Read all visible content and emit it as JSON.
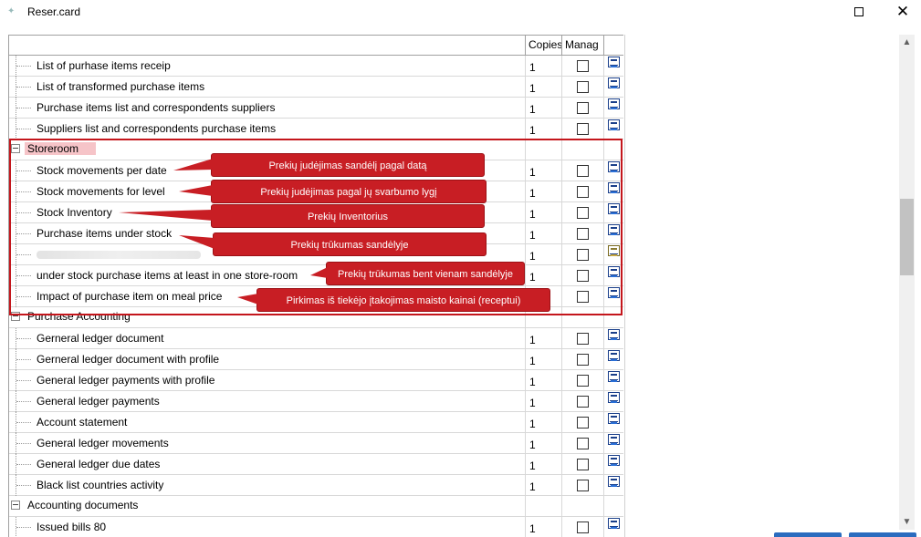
{
  "window": {
    "title": "Reser.card",
    "maximize_icon": "maximize-icon",
    "close_glyph": "✕"
  },
  "grid": {
    "columns": [
      "",
      "Copies",
      "Manag",
      ""
    ],
    "rows": [
      {
        "type": "item",
        "label": "List of purhase items receip",
        "copies": "1",
        "icon": "report-icon"
      },
      {
        "type": "item",
        "label": "List of transformed purchase items",
        "copies": "1",
        "icon": "report-icon"
      },
      {
        "type": "item",
        "label": "Purchase items list and correspondents suppliers",
        "copies": "1",
        "icon": "report-icon"
      },
      {
        "type": "item",
        "label": "Suppliers list and correspondents purchase items",
        "copies": "1",
        "icon": "report-icon"
      },
      {
        "type": "group",
        "label": "Storeroom",
        "selected": true
      },
      {
        "type": "item",
        "label": "Stock movements per date",
        "copies": "1",
        "icon": "report-icon"
      },
      {
        "type": "item",
        "label": "Stock movements for level",
        "copies": "1",
        "icon": "report-icon"
      },
      {
        "type": "item",
        "label": "Stock Inventory",
        "copies": "1",
        "icon": "report-icon"
      },
      {
        "type": "item",
        "label": "Purchase items under stock",
        "copies": "1",
        "icon": "report-icon"
      },
      {
        "type": "item",
        "label": "",
        "copies": "1",
        "icon": "report-alt-icon",
        "blurred": true
      },
      {
        "type": "item",
        "label": "under stock purchase items at least in one store-room",
        "copies": "1",
        "icon": "report-icon"
      },
      {
        "type": "item",
        "label": "Impact of purchase item on meal price",
        "copies": "",
        "icon": "report-icon"
      },
      {
        "type": "group",
        "label": "Purchase Accounting"
      },
      {
        "type": "item",
        "label": "Gerneral ledger document",
        "copies": "1",
        "icon": "report-icon"
      },
      {
        "type": "item",
        "label": "Gerneral ledger document with profile",
        "copies": "1",
        "icon": "report-icon"
      },
      {
        "type": "item",
        "label": "General ledger payments with profile",
        "copies": "1",
        "icon": "report-icon"
      },
      {
        "type": "item",
        "label": "General ledger payments",
        "copies": "1",
        "icon": "report-icon"
      },
      {
        "type": "item",
        "label": "Account statement",
        "copies": "1",
        "icon": "report-icon"
      },
      {
        "type": "item",
        "label": "General ledger movements",
        "copies": "1",
        "icon": "report-icon"
      },
      {
        "type": "item",
        "label": "General ledger due dates",
        "copies": "1",
        "icon": "report-icon"
      },
      {
        "type": "item",
        "label": "Black list countries activity",
        "copies": "1",
        "icon": "report-icon"
      },
      {
        "type": "group",
        "label": "Accounting documents"
      },
      {
        "type": "item",
        "label": "Issued bills 80",
        "copies": "1",
        "icon": "report-icon"
      }
    ]
  },
  "annotations": [
    {
      "text": "Prekių judėjimas sandėlį pagal datą"
    },
    {
      "text": "Prekių judėjimas pagal jų svarbumo lygį"
    },
    {
      "text": "Prekių Inventorius"
    },
    {
      "text": "Prekių trūkumas sandėlyje"
    },
    {
      "text": "Prekių trūkumas bent vienam sandėlyje"
    },
    {
      "text": "Pirkimas iš tiekėjo įtakojimas  maisto kainai (receptui)"
    }
  ],
  "colors": {
    "highlight": "#c4161c",
    "callout_bg": "#c81e24",
    "selection": "#f6c4c8",
    "accent": "#2b6cbf"
  }
}
